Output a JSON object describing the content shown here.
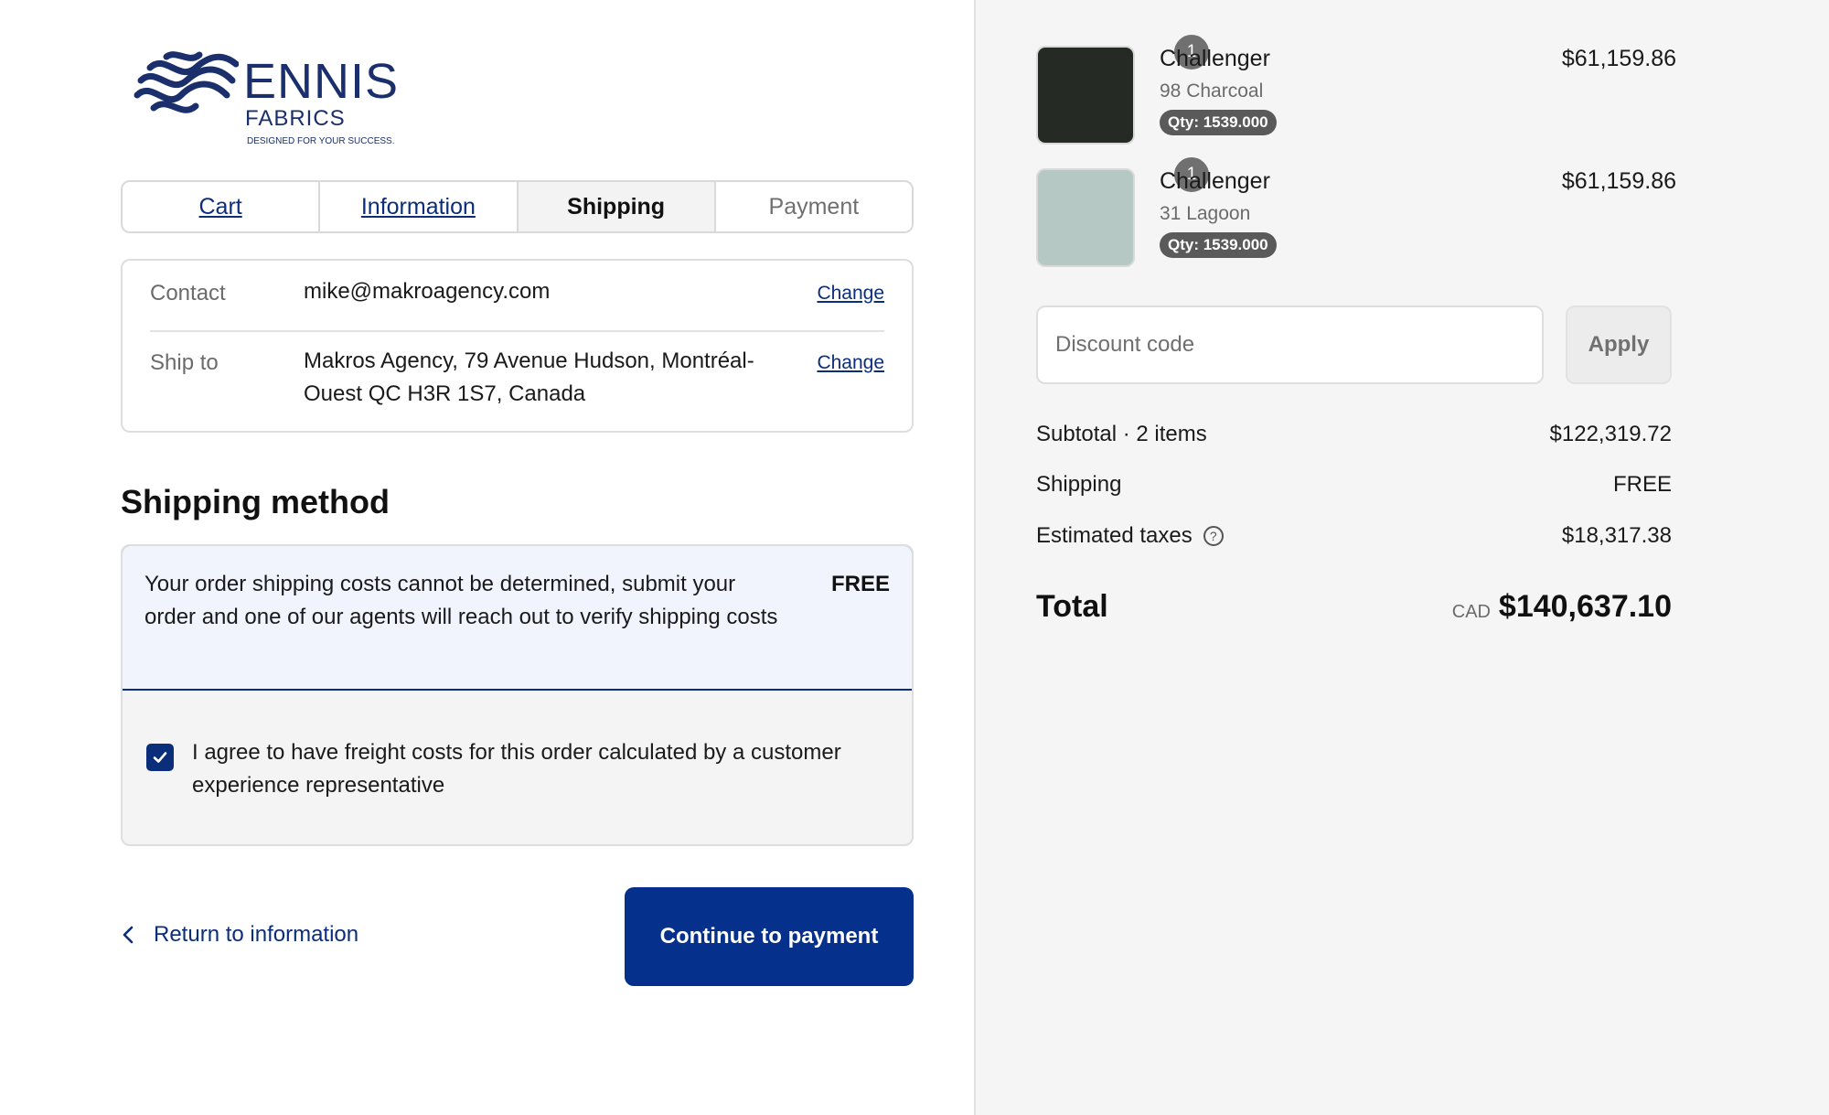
{
  "brand": {
    "name": "ENNIS",
    "sub": "FABRICS",
    "tagline": "DESIGNED FOR YOUR SUCCESS.",
    "color": "#1a2f6b"
  },
  "breadcrumb": {
    "cart": "Cart",
    "information": "Information",
    "shipping": "Shipping",
    "payment": "Payment",
    "active": "Shipping"
  },
  "review": {
    "contact_label": "Contact",
    "contact_value": "mike@makroagency.com",
    "ship_label": "Ship to",
    "ship_value": "Makros Agency, 79 Avenue Hudson, Montréal-Ouest QC H3R 1S7, Canada",
    "change_label": "Change"
  },
  "shipping_method": {
    "title": "Shipping method",
    "option_text": "Your order shipping costs cannot be determined, submit your order and one of our agents will reach out to verify shipping costs",
    "option_price": "FREE",
    "agree_text": "I agree to have freight costs for this order calculated by a customer experience representative",
    "agree_checked": true
  },
  "actions": {
    "return_label": "Return to information",
    "continue_label": "Continue to payment"
  },
  "order": {
    "items": [
      {
        "badge": "1",
        "name": "Challenger",
        "variant": "98 Charcoal",
        "qty": "Qty: 1539.000",
        "price": "$61,159.86",
        "swatch": "#262a24"
      },
      {
        "badge": "1",
        "name": "Challenger",
        "variant": "31 Lagoon",
        "qty": "Qty: 1539.000",
        "price": "$61,159.86",
        "swatch": "#b6c8c3"
      }
    ],
    "discount_placeholder": "Discount code",
    "apply_label": "Apply",
    "subtotal_label": "Subtotal · 2 items",
    "subtotal_value": "$122,319.72",
    "shipping_label": "Shipping",
    "shipping_value": "FREE",
    "taxes_label": "Estimated taxes",
    "taxes_value": "$18,317.38",
    "total_label": "Total",
    "currency": "CAD",
    "total_value": "$140,637.10"
  },
  "colors": {
    "accent": "#05308b",
    "link": "#0b2e7a",
    "sidebar_bg": "#f5f5f5"
  }
}
